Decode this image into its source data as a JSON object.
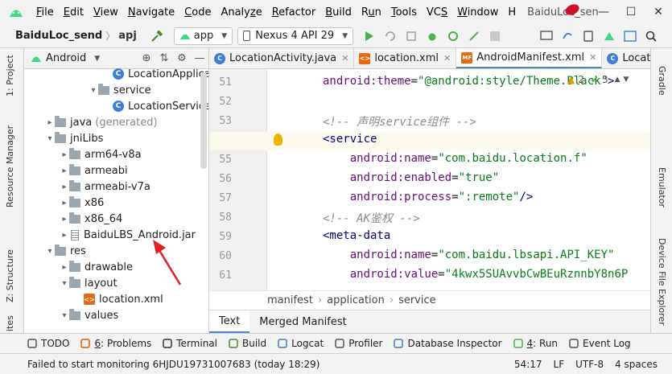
{
  "window": {
    "title": "BaiduLoc_sen",
    "menu": [
      "File",
      "Edit",
      "View",
      "Navigate",
      "Code",
      "Analyze",
      "Refactor",
      "Build",
      "Run",
      "Tools",
      "VCS",
      "Window",
      "H"
    ],
    "mnemonics": [
      "F",
      "E",
      "V",
      "N",
      "C",
      "z",
      "R",
      "B",
      "u",
      "T",
      "S",
      "W",
      ""
    ]
  },
  "toolbar": {
    "project": "BaiduLoc_send",
    "module": "apj",
    "run_config": "app",
    "device": "Nexus 4 API 29"
  },
  "left_tabs": [
    "1: Project",
    "Resource Manager",
    "Z: Structure",
    "ites"
  ],
  "project_panel": {
    "view": "Android",
    "tree": [
      {
        "label": "LocationApplication",
        "depth": 5,
        "kind": "class",
        "arrow": ""
      },
      {
        "label": "service",
        "depth": 4,
        "kind": "folder",
        "arrow": "▾"
      },
      {
        "label": "LocationService",
        "depth": 5,
        "kind": "class",
        "arrow": ""
      },
      {
        "label": "java",
        "suffix": "(generated)",
        "depth": 1,
        "kind": "folder",
        "arrow": "▸"
      },
      {
        "label": "jniLibs",
        "depth": 1,
        "kind": "folder",
        "arrow": "▾"
      },
      {
        "label": "arm64-v8a",
        "depth": 2,
        "kind": "folder",
        "arrow": "▸"
      },
      {
        "label": "armeabi",
        "depth": 2,
        "kind": "folder",
        "arrow": "▸"
      },
      {
        "label": "armeabi-v7a",
        "depth": 2,
        "kind": "folder",
        "arrow": "▸"
      },
      {
        "label": "x86",
        "depth": 2,
        "kind": "folder",
        "arrow": "▸"
      },
      {
        "label": "x86_64",
        "depth": 2,
        "kind": "folder",
        "arrow": "▸"
      },
      {
        "label": "BaiduLBS_Android.jar",
        "depth": 2,
        "kind": "jar",
        "arrow": "▸"
      },
      {
        "label": "res",
        "depth": 1,
        "kind": "folder",
        "arrow": "▾"
      },
      {
        "label": "drawable",
        "depth": 2,
        "kind": "folder",
        "arrow": "▸"
      },
      {
        "label": "layout",
        "depth": 2,
        "kind": "folder",
        "arrow": "▾"
      },
      {
        "label": "location.xml",
        "depth": 3,
        "kind": "xml",
        "arrow": ""
      },
      {
        "label": "values",
        "depth": 2,
        "kind": "folder",
        "arrow": "▾"
      }
    ]
  },
  "editor": {
    "tabs": [
      {
        "label": "LocationActivity.java",
        "icon": "C",
        "active": false
      },
      {
        "label": "location.xml",
        "icon": "<>",
        "active": false
      },
      {
        "label": "AndroidManifest.xml",
        "icon": "MF",
        "active": true
      },
      {
        "label": "Locati",
        "icon": "C",
        "active": false
      }
    ],
    "inspections": {
      "warnings": "2",
      "weak": "3"
    },
    "lines": [
      {
        "n": "51",
        "indent": "",
        "parts": [
          [
            "attr",
            "android:theme"
          ],
          [
            "plain",
            "="
          ],
          [
            "val",
            "\"@android:style/Theme.Black\""
          ],
          [
            "tag",
            ">"
          ]
        ]
      },
      {
        "n": "52",
        "indent": "",
        "parts": []
      },
      {
        "n": "53",
        "indent": "",
        "parts": [
          [
            "comment",
            "<!-- 声明service组件 -->"
          ]
        ]
      },
      {
        "n": "54",
        "indent": "",
        "parts": [
          [
            "tag",
            "<service"
          ]
        ]
      },
      {
        "n": "55",
        "indent": "    ",
        "parts": [
          [
            "attr",
            "android:name"
          ],
          [
            "plain",
            "="
          ],
          [
            "val",
            "\"com.baidu.location.f\""
          ]
        ]
      },
      {
        "n": "56",
        "indent": "    ",
        "parts": [
          [
            "attr",
            "android:enabled"
          ],
          [
            "plain",
            "="
          ],
          [
            "val",
            "\"true\""
          ]
        ]
      },
      {
        "n": "57",
        "indent": "    ",
        "parts": [
          [
            "attr",
            "android:process"
          ],
          [
            "plain",
            "="
          ],
          [
            "val",
            "\":remote\""
          ],
          [
            "tag",
            "/>"
          ]
        ]
      },
      {
        "n": "58",
        "indent": "",
        "parts": [
          [
            "comment",
            "<!-- AK鉴权 -->"
          ]
        ]
      },
      {
        "n": "59",
        "indent": "",
        "parts": [
          [
            "tag",
            "<meta-data"
          ]
        ]
      },
      {
        "n": "60",
        "indent": "    ",
        "parts": [
          [
            "attr",
            "android:name"
          ],
          [
            "plain",
            "="
          ],
          [
            "val",
            "\"com.baidu.lbsapi.API_KEY\""
          ]
        ]
      },
      {
        "n": "61",
        "indent": "    ",
        "parts": [
          [
            "attr",
            "android:value"
          ],
          [
            "plain",
            "="
          ],
          [
            "val",
            "\"4kwx5SUAvvbCwBEuRznnbY8n6P"
          ]
        ]
      }
    ],
    "breadcrumb": [
      "manifest",
      "application",
      "service"
    ],
    "subtabs": [
      "Text",
      "Merged Manifest"
    ]
  },
  "right_tabs": [
    "Gradle",
    "Emulator",
    "Device File Explorer"
  ],
  "tool_windows": [
    {
      "label": "TODO",
      "key": ""
    },
    {
      "label": "6: Problems",
      "key": "6"
    },
    {
      "label": "Terminal",
      "key": ""
    },
    {
      "label": "Build",
      "key": ""
    },
    {
      "label": "Logcat",
      "key": ""
    },
    {
      "label": "Profiler",
      "key": ""
    },
    {
      "label": "Database Inspector",
      "key": ""
    },
    {
      "label": "4: Run",
      "key": "4"
    },
    {
      "label": "Event Log",
      "key": ""
    }
  ],
  "status": {
    "message": "Failed to start monitoring 6HJDU19731007683 (today 18:29)",
    "position": "54:17",
    "line_sep": "LF",
    "encoding": "UTF-8",
    "indent": "4 spaces"
  }
}
